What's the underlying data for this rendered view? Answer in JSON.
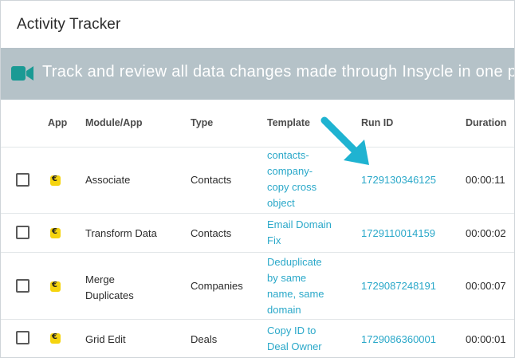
{
  "header": {
    "title": "Activity Tracker"
  },
  "banner": {
    "text": "Track and review all data changes made through Insycle in one place",
    "icon": "video-camera-icon",
    "color": "#b5c2c8",
    "icon_color": "#1a9a94"
  },
  "table": {
    "columns": [
      "App",
      "Module/App",
      "Type",
      "Template",
      "Run ID",
      "Duration"
    ],
    "rows": [
      {
        "app_icon": "hubspot-app-icon",
        "module": "Associate",
        "type": "Contacts",
        "template_lines": [
          "contacts-",
          "company-",
          "copy cross",
          "object"
        ],
        "run_id": "1729130346125",
        "duration": "00:00:11"
      },
      {
        "app_icon": "hubspot-app-icon",
        "module": "Transform Data",
        "type": "Contacts",
        "template_lines": [
          "Email Domain",
          "Fix"
        ],
        "run_id": "1729110014159",
        "duration": "00:00:02"
      },
      {
        "app_icon": "hubspot-app-icon",
        "module_lines": [
          "Merge",
          "Duplicates"
        ],
        "type": "Companies",
        "template_lines": [
          "Deduplicate",
          "by same",
          "name, same",
          "domain"
        ],
        "run_id": "1729087248191",
        "duration": "00:00:07"
      },
      {
        "app_icon": "hubspot-app-icon",
        "module": "Grid Edit",
        "type": "Deals",
        "template_lines": [
          "Copy ID to",
          "Deal Owner"
        ],
        "run_id": "1729086360001",
        "duration": "00:00:01"
      }
    ]
  },
  "colors": {
    "link": "#2aa8c9",
    "arrow": "#1fb3d1",
    "app_icon": "#f5d40f"
  },
  "annotation": {
    "icon": "pointer-arrow-icon"
  }
}
